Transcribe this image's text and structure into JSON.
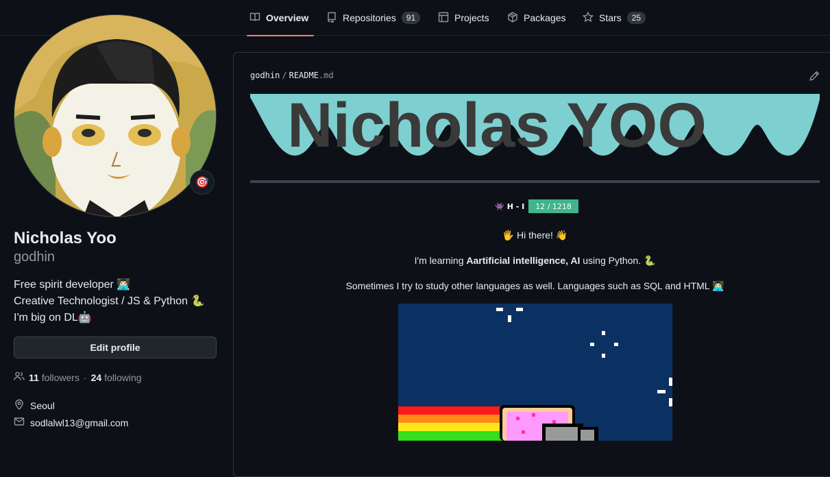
{
  "nav": {
    "tabs": [
      {
        "label": "Overview",
        "icon": "book-icon",
        "active": true
      },
      {
        "label": "Repositories",
        "icon": "repo-icon",
        "count": "91"
      },
      {
        "label": "Projects",
        "icon": "project-table-icon"
      },
      {
        "label": "Packages",
        "icon": "package-icon"
      },
      {
        "label": "Stars",
        "icon": "star-icon",
        "count": "25"
      }
    ]
  },
  "profile": {
    "status_emoji": "🎯",
    "full_name": "Nicholas Yoo",
    "login": "godhin",
    "bio_lines": [
      "Free spirit developer 👨🏻‍💻",
      "Creative Technologist / JS & Python 🐍",
      "I'm big on DL🤖"
    ],
    "edit_profile_label": "Edit profile",
    "followers_count": "11",
    "followers_label": "followers",
    "separator": "·",
    "following_count": "24",
    "following_label": "following",
    "location": "Seoul",
    "email": "sodlalwl13@gmail.com"
  },
  "readme": {
    "owner": "godhin",
    "path_sep": "/",
    "file_name": "README",
    "file_ext": ".md",
    "banner_text": "Nicholas YOO",
    "hits_label": "H - I",
    "hits_value": "12 / 1218",
    "greeting": "🖐 Hi there! 👋",
    "learning_prefix": "I'm learning ",
    "learning_bold": "Aartificial intelligence, AI",
    "learning_suffix": " using Python. 🐍",
    "languages_line": "Sometimes I try to study other languages as well. Languages such as SQL and HTML 👨🏻‍💻"
  },
  "colors": {
    "accent_tab": "#f78166",
    "banner_bg": "#7ecfd0",
    "hits_green": "#3fb58a",
    "nyan_sky": "#0b3162"
  }
}
